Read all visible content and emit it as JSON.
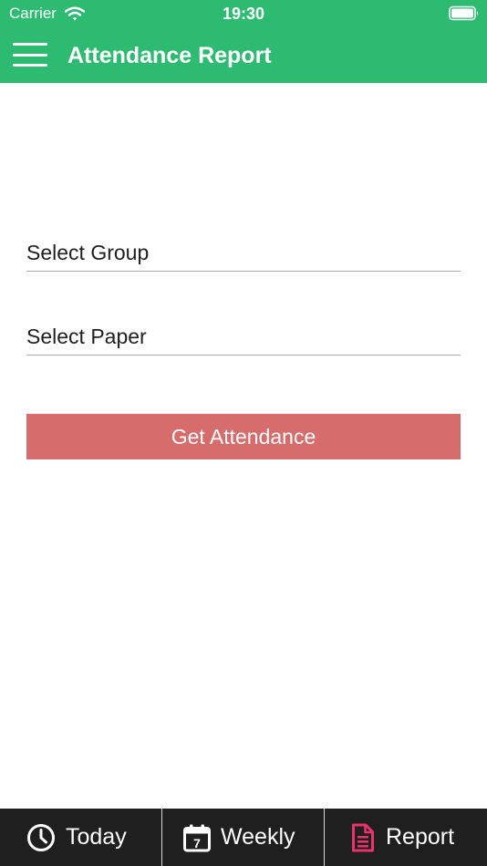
{
  "status_bar": {
    "carrier": "Carrier",
    "time": "19:30"
  },
  "header": {
    "title": "Attendance Report",
    "background_color": "#2dbb72",
    "menu_icon": "hamburger-menu-icon"
  },
  "form": {
    "group_label": "Select Group",
    "paper_label": "Select Paper",
    "submit_label": "Get Attendance",
    "submit_color": "#d66c6b"
  },
  "tabs": [
    {
      "label": "Today",
      "icon": "clock-icon",
      "active": false
    },
    {
      "label": "Weekly",
      "icon": "calendar-icon",
      "calendar_number": "7",
      "active": false
    },
    {
      "label": "Report",
      "icon": "document-icon",
      "active": true,
      "active_color": "#e8336b"
    }
  ]
}
